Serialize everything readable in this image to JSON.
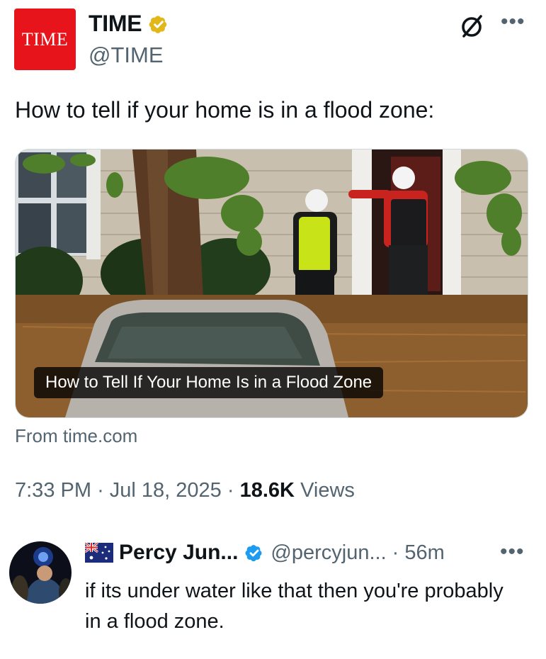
{
  "tweet": {
    "logo_text": "TIME",
    "display_name": "TIME",
    "handle": "@TIME",
    "text": "How to tell if your home is in a flood zone:",
    "card": {
      "headline": "How to Tell If Your Home Is in a Flood Zone",
      "source": "From time.com"
    },
    "time": "7:33 PM",
    "separator": "·",
    "date": "Jul 18, 2025",
    "views_count": "18.6K",
    "views_label": "Views",
    "icons": {
      "verified": "gold-verified-badge-icon",
      "grok": "grok-icon",
      "more": "more-icon"
    }
  },
  "reply": {
    "flag": "australia-flag-icon",
    "display_name": "Percy Jun...",
    "handle": "@percyjun...",
    "separator": "·",
    "age": "56m",
    "text": "if its under water like that then you're probably in a flood zone.",
    "icons": {
      "verified": "blue-verified-badge-icon",
      "more": "more-icon"
    }
  },
  "colors": {
    "brand_red": "#e8141c",
    "gold_badge": "#e2b719",
    "blue_badge": "#1d9bf0",
    "secondary_text": "#536471",
    "primary_text": "#0f1419"
  }
}
